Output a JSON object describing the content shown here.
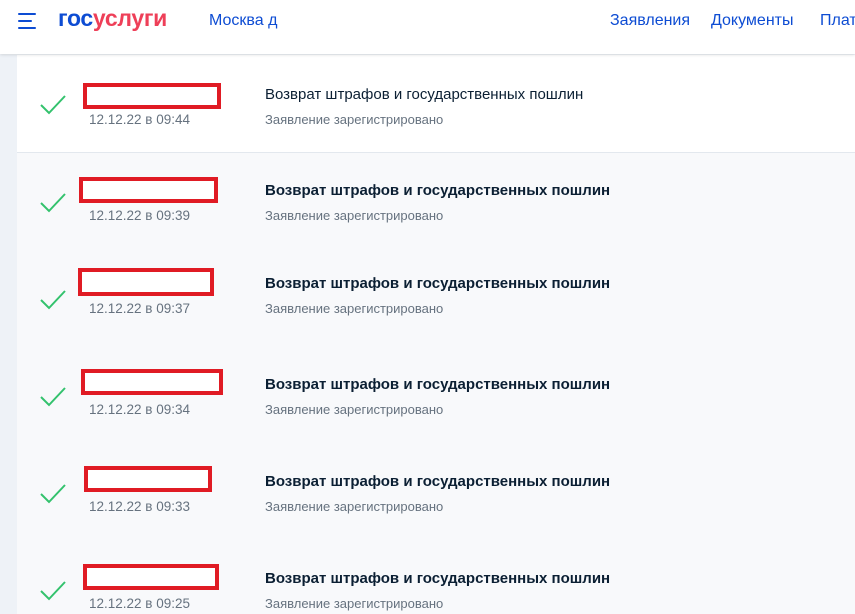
{
  "header": {
    "logo_part1": "гос",
    "logo_part2": "услуги",
    "city": "Москва д",
    "nav": [
      "Заявления",
      "Документы",
      "Плат"
    ]
  },
  "colors": {
    "brand_blue": "#0d4cd3",
    "brand_red": "#ee3f58",
    "check_green": "#33c26d",
    "redaction": "#e01b24"
  },
  "applications": [
    {
      "title": "Возврат штрафов и государственных пошлин",
      "date": "12.12.22 в 09:44",
      "status": "Заявление зарегистрировано",
      "bold": false,
      "icon": "checkmark-icon"
    },
    {
      "title": "Возврат штрафов и государственных пошлин",
      "date": "12.12.22 в 09:39",
      "status": "Заявление зарегистрировано",
      "bold": true,
      "icon": "checkmark-icon"
    },
    {
      "title": "Возврат штрафов и государственных пошлин",
      "date": "12.12.22 в 09:37",
      "status": "Заявление зарегистрировано",
      "bold": true,
      "icon": "checkmark-icon"
    },
    {
      "title": "Возврат штрафов и государственных пошлин",
      "date": "12.12.22 в 09:34",
      "status": "Заявление зарегистрировано",
      "bold": true,
      "icon": "checkmark-icon"
    },
    {
      "title": "Возврат штрафов и государственных пошлин",
      "date": "12.12.22 в 09:33",
      "status": "Заявление зарегистрировано",
      "bold": true,
      "icon": "checkmark-icon"
    },
    {
      "title": "Возврат штрафов и государственных пошлин",
      "date": "12.12.22 в 09:25",
      "status": "Заявление зарегистрировано",
      "bold": true,
      "icon": "checkmark-icon"
    }
  ]
}
